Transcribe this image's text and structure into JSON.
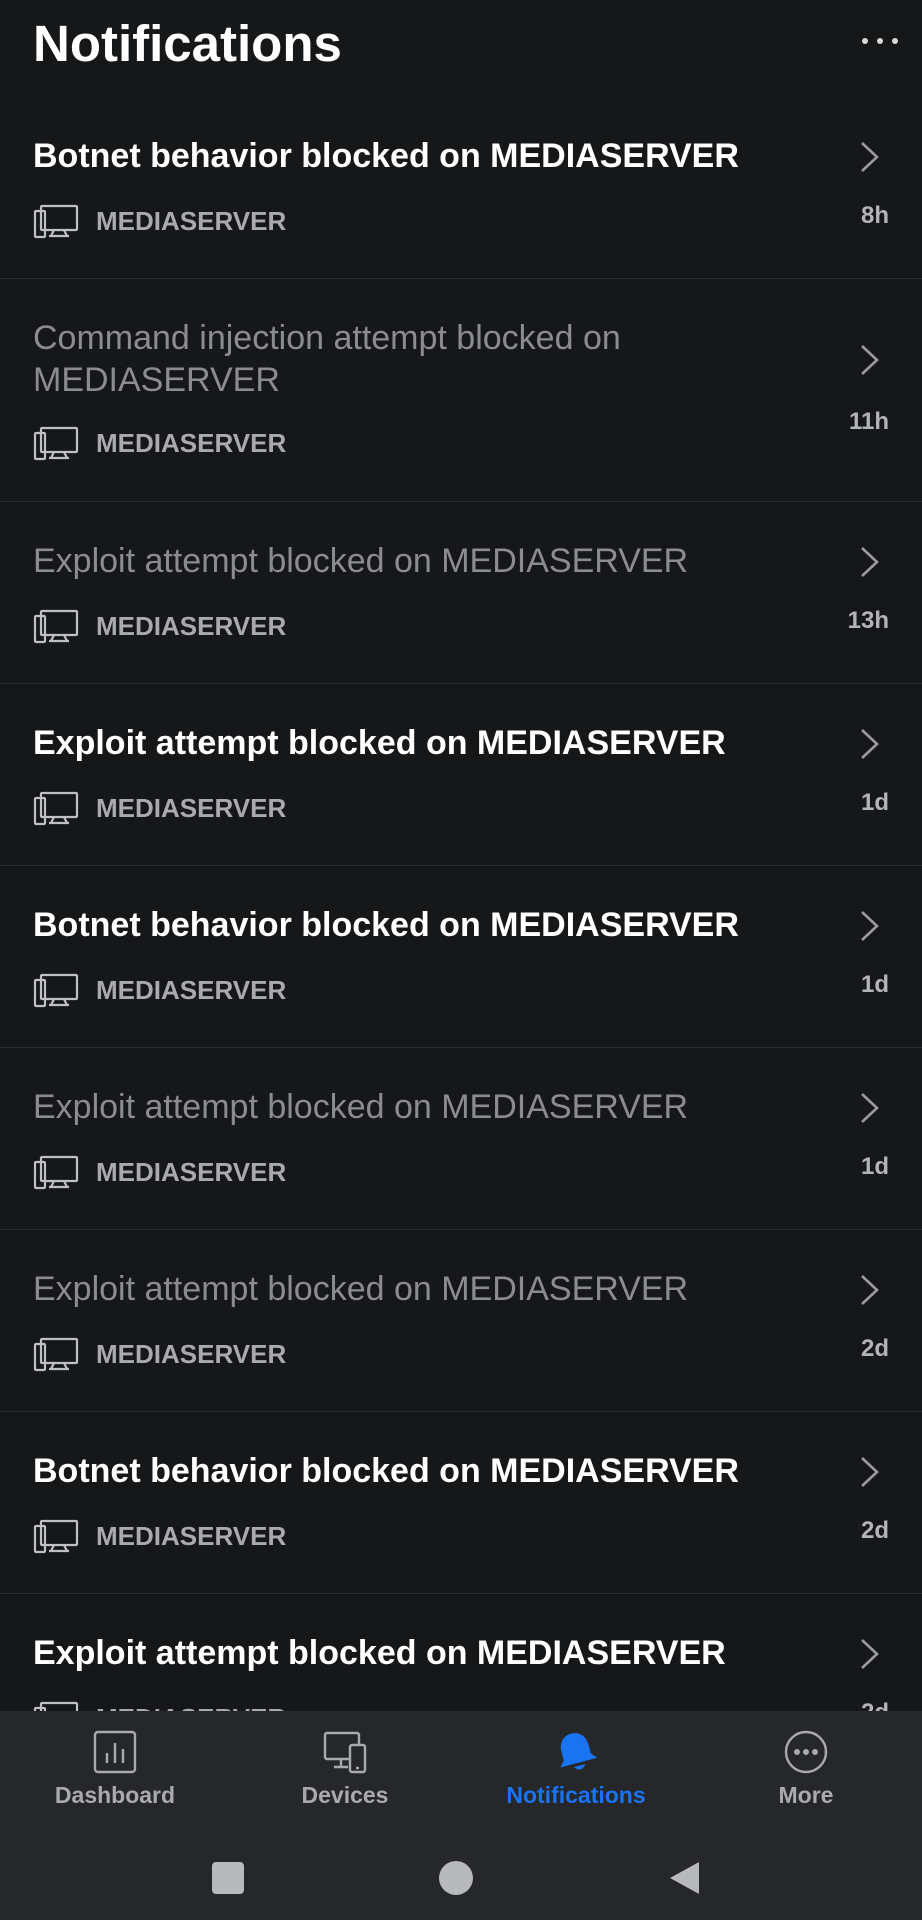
{
  "header": {
    "title": "Notifications",
    "more_icon": "more-horizontal-icon"
  },
  "notifications": [
    {
      "title": "Botnet behavior blocked on MEDIASERVER",
      "device": "MEDIASERVER",
      "time": "8h",
      "read": false
    },
    {
      "title": "Command injection attempt blocked on MEDIASERVER",
      "device": "MEDIASERVER",
      "time": "11h",
      "read": true
    },
    {
      "title": "Exploit attempt blocked on MEDIASERVER",
      "device": "MEDIASERVER",
      "time": "13h",
      "read": true
    },
    {
      "title": "Exploit attempt blocked on MEDIASERVER",
      "device": "MEDIASERVER",
      "time": "1d",
      "read": false
    },
    {
      "title": "Botnet behavior blocked on MEDIASERVER",
      "device": "MEDIASERVER",
      "time": "1d",
      "read": false
    },
    {
      "title": "Exploit attempt blocked on MEDIASERVER",
      "device": "MEDIASERVER",
      "time": "1d",
      "read": true
    },
    {
      "title": "Exploit attempt blocked on MEDIASERVER",
      "device": "MEDIASERVER",
      "time": "2d",
      "read": true
    },
    {
      "title": "Botnet behavior blocked on MEDIASERVER",
      "device": "MEDIASERVER",
      "time": "2d",
      "read": false
    },
    {
      "title": "Exploit attempt blocked on MEDIASERVER",
      "device": "MEDIASERVER",
      "time": "2d",
      "read": false
    }
  ],
  "bottom_nav": {
    "tabs": [
      {
        "label": "Dashboard",
        "icon": "bar-chart-icon",
        "active": false
      },
      {
        "label": "Devices",
        "icon": "devices-icon",
        "active": false
      },
      {
        "label": "Notifications",
        "icon": "bell-icon",
        "active": true
      },
      {
        "label": "More",
        "icon": "more-circle-icon",
        "active": false
      }
    ]
  },
  "system_nav": {
    "buttons": [
      "recents-square-icon",
      "home-circle-icon",
      "back-triangle-icon"
    ]
  },
  "colors": {
    "background": "#161719",
    "nav_background": "#26272b",
    "accent": "#1a73f0",
    "read_text": "#8b8c90",
    "secondary_text": "#a9aaae"
  }
}
